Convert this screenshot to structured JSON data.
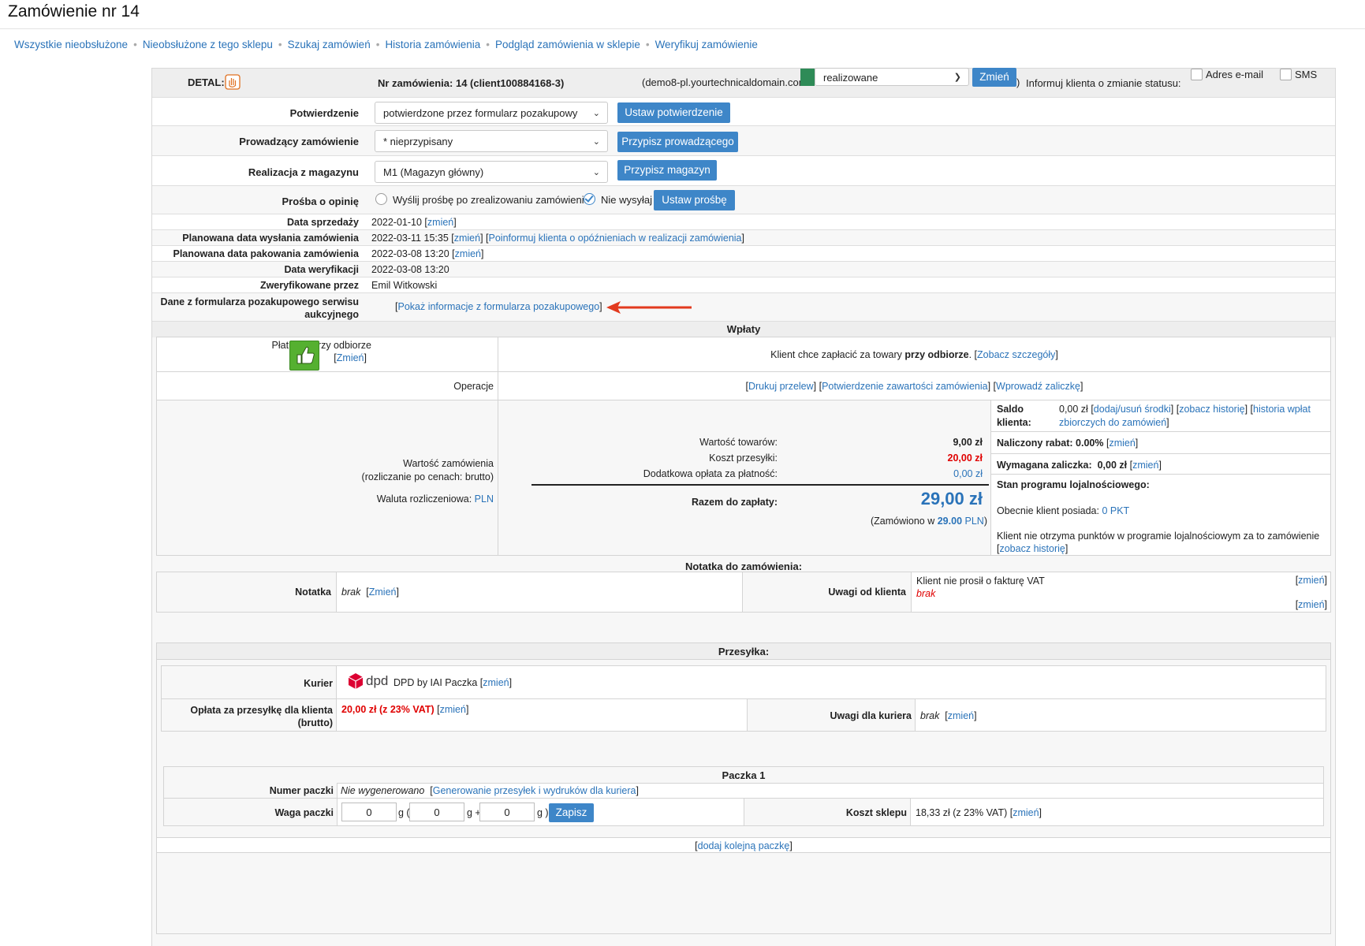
{
  "page": {
    "title": "Zamówienie nr 14"
  },
  "nav": {
    "items": [
      "Wszystkie nieobsłużone",
      "Nieobsłużone z tego sklepu",
      "Szukaj zamówień",
      "Historia zamówienia",
      "Podgląd zamówienia w sklepie",
      "Weryfikuj zamówienie"
    ],
    "sep": "•"
  },
  "header": {
    "detal_label": "DETAL:",
    "order_number": "Nr zamówienia: 14 (client100884168-3)",
    "domain": "(demo8-pl.yourtechnicaldomain.com",
    "status_value": "realizowane",
    "status_color": "#2e8b57",
    "change_button": "Zmień",
    "paren": ")",
    "inform_text": "Informuj klienta o zmianie statusu:",
    "email_label": "Adres e-mail",
    "sms_label": "SMS"
  },
  "form": {
    "confirmation": {
      "label": "Potwierdzenie",
      "value": "potwierdzone przez formularz pozakupowy",
      "button": "Ustaw potwierdzenie"
    },
    "handler": {
      "label": "Prowadzący zamówienie",
      "value": "* nieprzypisany",
      "button": "Przypisz prowadzącego"
    },
    "warehouse": {
      "label": "Realizacja z magazynu",
      "value": "M1 (Magazyn główny)",
      "button": "Przypisz magazyn"
    },
    "opinion": {
      "label": "Prośba o opinię",
      "option1": "Wyślij prośbę po zrealizowaniu zamówienia",
      "option2": "Nie wysyłaj",
      "button": "Ustaw prośbę"
    }
  },
  "info": {
    "sale_date": {
      "label": "Data sprzedaży",
      "value": "2022-01-10",
      "link": "zmień"
    },
    "ship_date": {
      "label": "Planowana data wysłania zamówienia",
      "value": "2022-03-11 15:35",
      "link": "zmień",
      "link2": "Poinformuj klienta o opóźnieniach w realizacji zamówienia"
    },
    "pack_date": {
      "label": "Planowana data pakowania zamówienia",
      "value": "2022-03-08 13:20",
      "link": "zmień"
    },
    "verify_date": {
      "label": "Data weryfikacji",
      "value": "2022-03-08 13:20"
    },
    "verified_by": {
      "label": "Zweryfikowane przez",
      "value": "Emil Witkowski"
    },
    "form_data": {
      "label1": "Dane z formularza pozakupowego serwisu",
      "label2": "aukcyjnego",
      "link": "Pokaż informacje z formularza pozakupowego"
    }
  },
  "payments": {
    "title": "Wpłaty",
    "method": "Płatność przy odbiorze",
    "method_link": "Zmień",
    "desc_prefix": "Klient chce zapłacić za towary ",
    "desc_bold": "przy odbiorze",
    "desc_suffix": ".",
    "details_link": "Zobacz szczegóły",
    "operations_label": "Operacje",
    "op1": "Drukuj przelew",
    "op2": "Potwierdzenie zawartości zamówienia",
    "op3": "Wprowadź zaliczkę",
    "order_value_label": "Wartość zamówienia",
    "order_value_sub": "(rozliczanie po cenach: brutto)",
    "currency_label": "Waluta rozliczeniowa:",
    "currency": "PLN",
    "goods_label": "Wartość towarów:",
    "goods_value": "9,00 zł",
    "shipping_label": "Koszt przesyłki:",
    "shipping_value": "20,00 zł",
    "fee_label": "Dodatkowa opłata za płatność:",
    "fee_value": "0,00 zł",
    "total_label": "Razem do zapłaty:",
    "total_value": "29,00 zł",
    "ordered_prefix": "(Zamówiono w ",
    "ordered_value": "29.00",
    "ordered_currency": "PLN",
    "ordered_suffix": ")",
    "balance_label1": "Saldo",
    "balance_label2": "klienta:",
    "balance_value": "0,00 zł",
    "balance_link1": "dodaj/usuń środki",
    "balance_link2": "zobacz historię",
    "balance_link3a": "historia wpłat",
    "balance_link3b": "zbiorczych do zamówień",
    "discount_label": "Naliczony rabat:",
    "discount_value": "0.00%",
    "discount_link": "zmień",
    "deposit_label": "Wymagana zaliczka:",
    "deposit_value": "0,00 zł",
    "deposit_link": "zmień",
    "loyalty_title": "Stan programu lojalnościowego:",
    "loyalty_has": "Obecnie klient posiada:",
    "loyalty_points": "0 PKT",
    "loyalty_note": "Klient nie otrzyma punktów w programie lojalnościowym za to zamówienie",
    "loyalty_link": "zobacz historię"
  },
  "note": {
    "title": "Notatka do zamówienia:",
    "label": "Notatka",
    "value": "brak",
    "link": "Zmień",
    "client_label": "Uwagi od klienta",
    "client_text1": "Klient nie prosił o fakturę VAT",
    "client_text2": "brak",
    "link_right1": "zmień",
    "link_right2": "zmień"
  },
  "shipping": {
    "title": "Przesyłka:",
    "courier_label": "Kurier",
    "courier_logo_text": "dpd",
    "courier_name": "DPD by IAI Paczka",
    "courier_link": "zmień",
    "fee_label1": "Opłata za przesyłkę dla klienta",
    "fee_label2": "(brutto)",
    "fee_value": "20,00 zł (z 23% VAT)",
    "fee_link": "zmień",
    "courier_notes_label": "Uwagi dla kuriera",
    "courier_notes_value": "brak",
    "courier_notes_link": "zmień"
  },
  "package": {
    "title": "Paczka 1",
    "number_label": "Numer paczki",
    "number_value": "Nie wygenerowano",
    "number_link": "Generowanie przesyłek i wydruków dla kuriera",
    "weight_label": "Waga paczki",
    "w1": "0",
    "u1": "g (",
    "w2": "0",
    "u2": "g +",
    "w3": "0",
    "u3": "g )",
    "save_button": "Zapisz",
    "cost_label": "Koszt sklepu",
    "cost_value": "18,33 zł (z 23% VAT)",
    "cost_link": "zmień",
    "add_link": "dodaj kolejną paczkę"
  }
}
